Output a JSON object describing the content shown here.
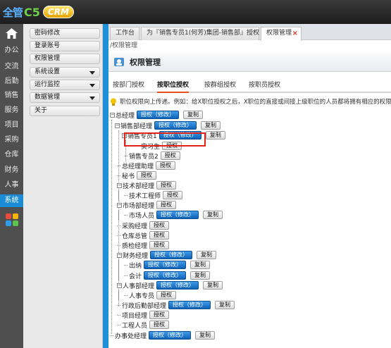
{
  "app": {
    "logo_part1": "全管",
    "logo_part2": "C5",
    "logo_part3": "CRM"
  },
  "leftnav": {
    "items": [
      "办公",
      "交流",
      "后勤",
      "销售",
      "服务",
      "项目",
      "采购",
      "仓库",
      "财务",
      "人事",
      "系统"
    ],
    "active": "系统"
  },
  "submenu": {
    "items": [
      {
        "label": "密码修改",
        "caret": false
      },
      {
        "label": "登录账号",
        "caret": false
      },
      {
        "label": "权限管理",
        "caret": false
      },
      {
        "label": "系统设置",
        "caret": true
      },
      {
        "label": "运行监控",
        "caret": true
      },
      {
        "label": "数据管理",
        "caret": true
      },
      {
        "label": "关于",
        "caret": false
      }
    ]
  },
  "window_tabs": [
    {
      "label": "工作台"
    },
    {
      "label": "为『销售专员1(何芳)集团-销售部』授权"
    },
    {
      "label": "权限管理",
      "close": "×"
    }
  ],
  "breadcrumb": "/权限管理",
  "page_title": "权限管理",
  "subtabs": [
    "按部门授权",
    "按职位授权",
    "按群组授权",
    "按职员授权"
  ],
  "active_subtab": "按职位授权",
  "hint": "职位权限向上传递。例如：给X职位授权之后，X职位的直接或间接上级职位的人员都将拥有相应的权限",
  "buttons": {
    "grant": "授权",
    "grant_edit": "授权（修改）",
    "copy": "复制"
  },
  "tree": [
    {
      "label": "总经理",
      "blue": true,
      "copy": true
    },
    {
      "label": "销售部经理",
      "blue": true,
      "copy": true
    },
    {
      "label": "销售专员1",
      "blue": true,
      "copy": true
    },
    {
      "label": "实习生",
      "blue": false,
      "copy": false
    },
    {
      "label": "销售专员2",
      "blue": false,
      "copy": false
    },
    {
      "label": "总经理助理",
      "blue": false,
      "copy": false
    },
    {
      "label": "秘书",
      "blue": false,
      "copy": false
    },
    {
      "label": "技术部经理",
      "blue": false,
      "copy": false
    },
    {
      "label": "技术工程师",
      "blue": false,
      "copy": false
    },
    {
      "label": "市场部经理",
      "blue": false,
      "copy": false
    },
    {
      "label": "市场人员",
      "blue": true,
      "copy": true
    },
    {
      "label": "采购经理",
      "blue": false,
      "copy": false
    },
    {
      "label": "仓库总管",
      "blue": false,
      "copy": false
    },
    {
      "label": "质检经理",
      "blue": false,
      "copy": false
    },
    {
      "label": "财务经理",
      "blue": true,
      "copy": true
    },
    {
      "label": "出纳",
      "blue": true,
      "copy": true
    },
    {
      "label": "会计",
      "blue": true,
      "copy": true
    },
    {
      "label": "人事部经理",
      "blue": true,
      "copy": true
    },
    {
      "label": "人事专员",
      "blue": false,
      "copy": false
    },
    {
      "label": "行政后勤部经理",
      "blue": true,
      "copy": true
    },
    {
      "label": "项目经理",
      "blue": false,
      "copy": false
    },
    {
      "label": "工程人员",
      "blue": false,
      "copy": false
    },
    {
      "label": "办事处经理",
      "blue": true,
      "copy": true
    }
  ]
}
